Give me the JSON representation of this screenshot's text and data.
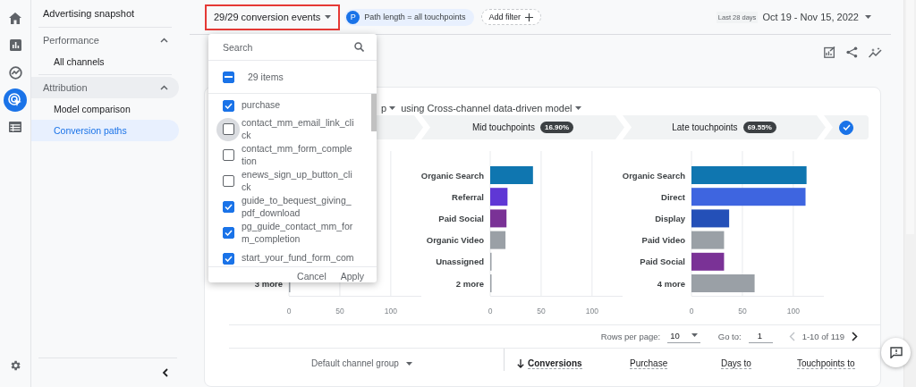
{
  "rail": {
    "items": [
      {
        "kind": "home",
        "selected": false
      },
      {
        "kind": "reports",
        "selected": false
      },
      {
        "kind": "explore",
        "selected": false
      },
      {
        "kind": "advertising",
        "selected": true
      },
      {
        "kind": "configure",
        "selected": false
      }
    ],
    "settings": {
      "kind": "settings"
    }
  },
  "sidebar": {
    "title": "Advertising snapshot",
    "sections": [
      {
        "label": "Performance",
        "expanded": true,
        "active": false,
        "items": [
          {
            "label": "All channels",
            "selected": false
          }
        ]
      },
      {
        "label": "Attribution",
        "expanded": true,
        "active": true,
        "items": [
          {
            "label": "Model comparison",
            "selected": false
          },
          {
            "label": "Conversion paths",
            "selected": true
          }
        ]
      }
    ]
  },
  "toolbar": {
    "events_button": "29/29 conversion events",
    "events_highlighted": true,
    "filter_chip": {
      "badge": "P",
      "label": "Path length = all touchpoints"
    },
    "add_filter": "Add filter",
    "date_badge": "Last 28 days",
    "date_range": "Oct 19 - Nov 15, 2022"
  },
  "card": {
    "title_fragment": "p",
    "title_model": "using Cross-channel data-driven model",
    "steps": [
      {
        "label": "Mid touchpoints",
        "badge": "16.90%"
      },
      {
        "label": "Late touchpoints",
        "badge": "69.55%"
      }
    ],
    "all_steps_checked": true,
    "charts": [
      {
        "chart_data": {
          "type": "bar",
          "orientation": "horizontal",
          "categories": [
            "3 more"
          ],
          "values": [
            1
          ],
          "colors": [
            "#9aa0a6"
          ],
          "xticks": [
            0,
            50,
            100
          ],
          "xlim": [
            0,
            130
          ]
        }
      },
      {
        "chart_data": {
          "type": "bar",
          "orientation": "horizontal",
          "categories": [
            "Organic Search",
            "Referral",
            "Paid Social",
            "Organic Video",
            "Unassigned",
            "2 more"
          ],
          "values": [
            42,
            17,
            16,
            15,
            1,
            1
          ],
          "colors": [
            "#0f76b0",
            "#5f37d5",
            "#7a3296",
            "#9aa0a6",
            "#9aa0a6",
            "#9aa0a6"
          ],
          "xticks": [
            0,
            50,
            100
          ],
          "xlim": [
            0,
            130
          ]
        }
      },
      {
        "chart_data": {
          "type": "bar",
          "orientation": "horizontal",
          "categories": [
            "Organic Search",
            "Direct",
            "Display",
            "Paid Video",
            "Paid Social",
            "4 more"
          ],
          "values": [
            113,
            112,
            37,
            32,
            32,
            62
          ],
          "colors": [
            "#0f76b0",
            "#3e65e0",
            "#2450b8",
            "#9aa0a6",
            "#7a3296",
            "#9aa0a6"
          ],
          "xticks": [
            0,
            50,
            100
          ],
          "xlim": [
            0,
            130
          ]
        }
      }
    ],
    "pagination": {
      "rows_label": "Rows per page:",
      "rows_value": "10",
      "goto_label": "Go to:",
      "goto_value": "1",
      "range": "1-10 of 119"
    },
    "table": {
      "columns": [
        {
          "label": "Default channel group",
          "kind": "dimension",
          "sorted": false
        },
        {
          "label": "Conversions",
          "kind": "metric",
          "sorted": true
        },
        {
          "label": "Purchase",
          "kind": "metric",
          "sorted": false
        },
        {
          "label": "Days to",
          "kind": "metric",
          "sorted": false
        },
        {
          "label": "Touchpoints to",
          "kind": "metric",
          "sorted": false
        }
      ]
    }
  },
  "dropdown": {
    "search_placeholder": "Search",
    "select_all": {
      "label": "29 items",
      "indeterminate": true
    },
    "items": [
      {
        "label": "purchase",
        "checked": true,
        "focused": false
      },
      {
        "label": "contact_mm_email_link_click",
        "checked": false,
        "focused": true
      },
      {
        "label": "contact_mm_form_completion",
        "checked": false,
        "focused": false
      },
      {
        "label": "enews_sign_up_button_click",
        "checked": false,
        "focused": false
      },
      {
        "label": "guide_to_bequest_giving_pdf_download",
        "checked": true,
        "focused": false
      },
      {
        "label": "pg_guide_contact_mm_form_completion",
        "checked": true,
        "focused": false
      },
      {
        "label": "start_your_fund_form_com",
        "checked": true,
        "focused": false
      }
    ],
    "cancel": "Cancel",
    "apply": "Apply"
  }
}
